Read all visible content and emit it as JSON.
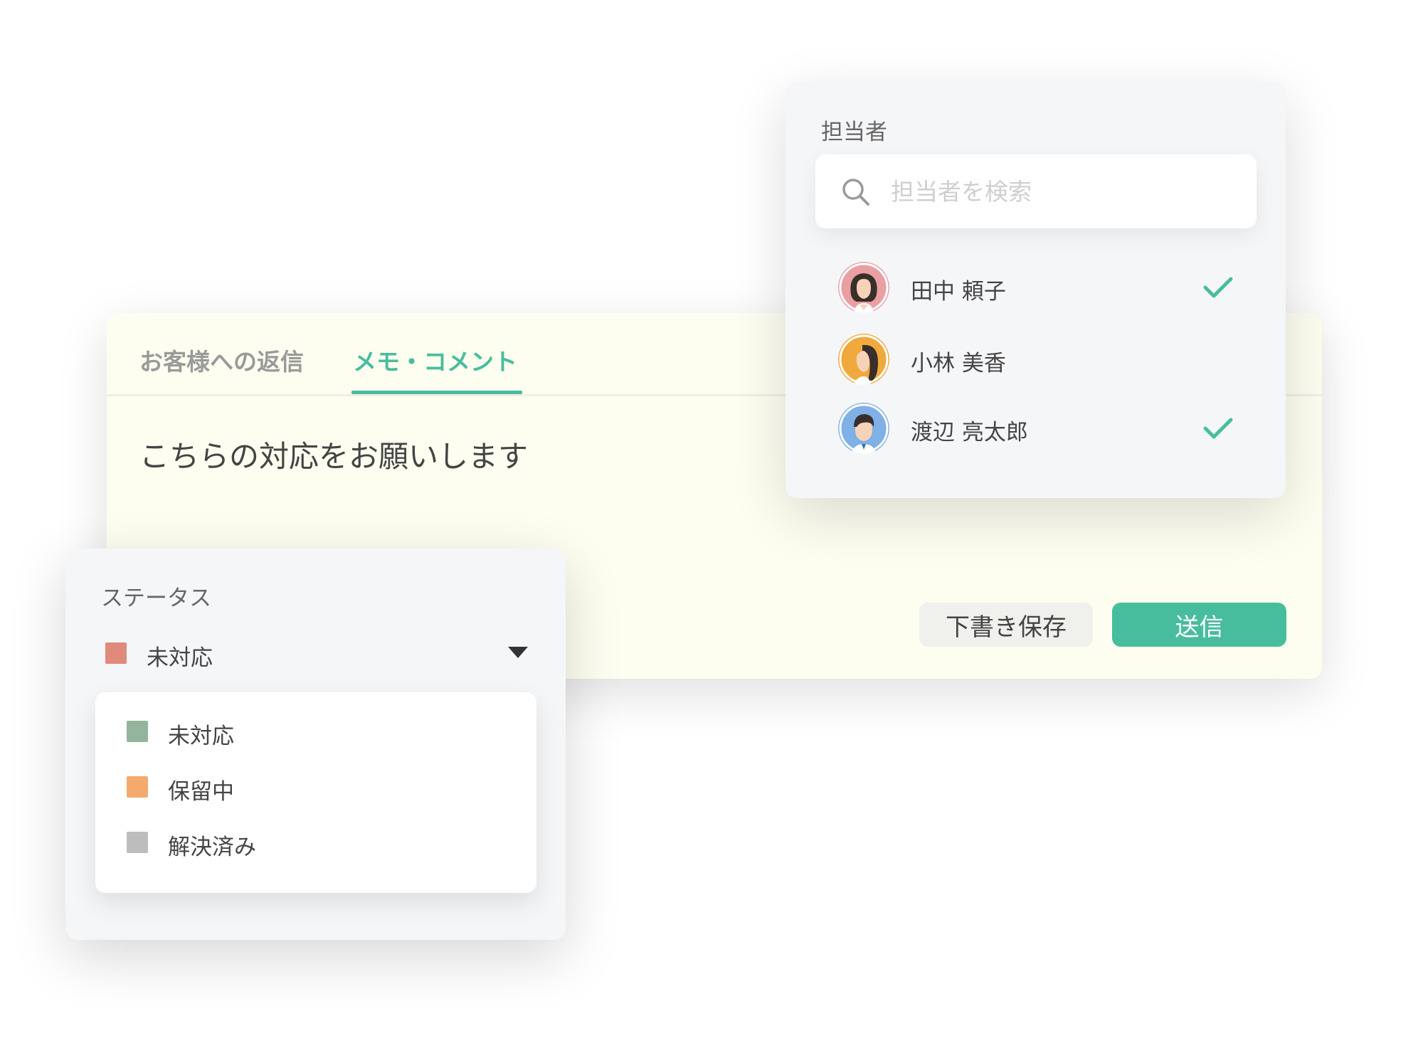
{
  "compose": {
    "tabs": [
      {
        "label": "お客様への返信",
        "active": false
      },
      {
        "label": "メモ・コメント",
        "active": true
      }
    ],
    "body_text": "こちらの対応をお願いします",
    "draft_button": "下書き保存",
    "send_button": "送信"
  },
  "assignee": {
    "title": "担当者",
    "search_placeholder": "担当者を検索",
    "members": [
      {
        "name": "田中 頼子",
        "selected": true,
        "avatar_color": "#e9a0a3",
        "avatar_icon": "woman-avatar-icon"
      },
      {
        "name": "小林 美香",
        "selected": false,
        "avatar_color": "#f0a93c",
        "avatar_icon": "woman-profile-avatar-icon"
      },
      {
        "name": "渡辺 亮太郎",
        "selected": true,
        "avatar_color": "#7fb0e6",
        "avatar_icon": "man-avatar-icon"
      }
    ]
  },
  "status": {
    "title": "ステータス",
    "current": {
      "label": "未対応",
      "color": "#e08a7b"
    },
    "options": [
      {
        "label": "未対応",
        "color": "#93b59d"
      },
      {
        "label": "保留中",
        "color": "#f5a96d"
      },
      {
        "label": "解決済み",
        "color": "#bdbdbd"
      }
    ]
  },
  "colors": {
    "accent": "#48bd9d",
    "compose_background": "#fdfdf0",
    "panel_background": "#f5f6f8"
  }
}
